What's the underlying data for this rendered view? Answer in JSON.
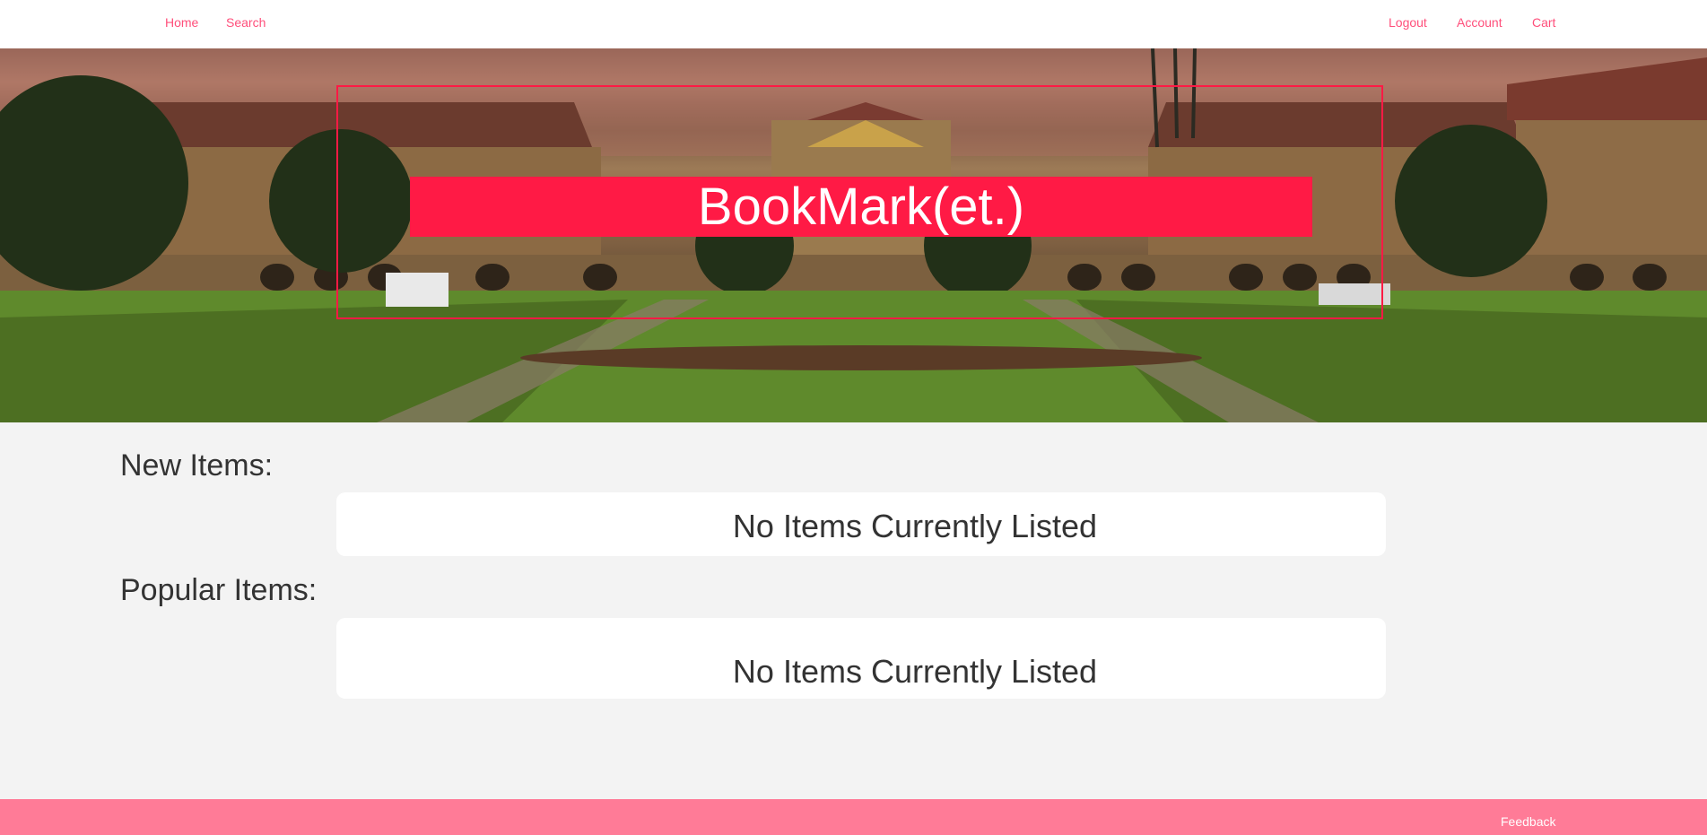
{
  "nav": {
    "left": [
      "Home",
      "Search"
    ],
    "right": [
      "Logout",
      "Account",
      "Cart"
    ]
  },
  "hero": {
    "title": "BookMark(et.)"
  },
  "sections": {
    "new_items": {
      "heading": "New Items:",
      "empty_message": "No Items Currently Listed"
    },
    "popular_items": {
      "heading": "Popular Items:",
      "empty_message": "No Items Currently Listed"
    }
  },
  "footer": {
    "feedback_label": "Feedback"
  },
  "colors": {
    "accent": "#ff1a45",
    "nav_link": "#ff4f7b",
    "footer": "#ff7b97",
    "page_bg": "#f3f3f3"
  }
}
